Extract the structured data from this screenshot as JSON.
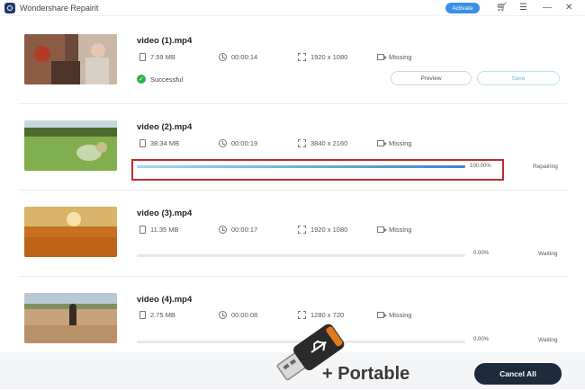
{
  "app": {
    "title": "Wondershare Repairit",
    "activate_label": "Activate",
    "icons": [
      "cart-icon",
      "menu-icon",
      "minimize-icon",
      "close-icon"
    ]
  },
  "files": [
    {
      "name": "video (1).mp4",
      "size": "7.59  MB",
      "duration": "00:00:14",
      "resolution": "1920 x 1080",
      "audio": "Missing",
      "status": "Successful",
      "preview_label": "Preview",
      "save_label": "Save"
    },
    {
      "name": "video (2).mp4",
      "size": "38.34  MB",
      "duration": "00:00:19",
      "resolution": "3840 x 2160",
      "audio": "Missing",
      "progress": 1.0,
      "progress_text": "100.00%",
      "status": "Repairing"
    },
    {
      "name": "video (3).mp4",
      "size": "11.35  MB",
      "duration": "00:00:17",
      "resolution": "1920 x 1080",
      "audio": "Missing",
      "progress": 0.0,
      "progress_text": "0.00%",
      "status": "Waiting"
    },
    {
      "name": "video (4).mp4",
      "size": "2.75  MB",
      "duration": "00:00:08",
      "resolution": "1280 x 720",
      "audio": "Missing",
      "progress": 0.0,
      "progress_text": "0.00%",
      "status": "Waiting"
    }
  ],
  "footer": {
    "cancel_label": "Cancel All",
    "portable_label": "+ Portable"
  },
  "colors": {
    "accent": "#3a90e6",
    "success": "#2fb34a",
    "highlight": "#c52a2a",
    "cancel_bg": "#1d2a3e"
  }
}
